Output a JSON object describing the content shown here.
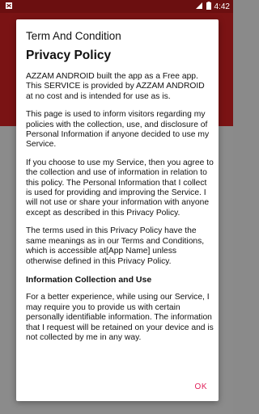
{
  "status_bar": {
    "time": "4:42"
  },
  "dialog": {
    "title": "Term And Condition",
    "heading": "Privacy Policy",
    "paragraphs": [
      "AZZAM ANDROID built the app as a Free app. This SERVICE is provided by AZZAM ANDROID at no cost and is intended for use as is.",
      "This page is used to inform visitors regarding my policies with the collection, use, and disclosure of Personal Information if anyone decided to use my Service.",
      "If you choose to use my Service, then you agree to the collection and use of information in relation to this policy. The Personal Information that I collect is used for providing and improving the Service. I will not use or share your information with anyone except as described in this Privacy Policy.",
      "The terms used in this Privacy Policy have the same meanings as in our Terms and Conditions, which is accessible at[App Name] unless otherwise defined in this Privacy Policy."
    ],
    "section_heading": "Information Collection and Use",
    "section_paragraph": "For a better experience, while using our Service, I may require you to provide us with certain personally identifiable information. The information that I request will be retained on your device and is not collected by me in any way.",
    "ok_label": "OK"
  },
  "colors": {
    "status_bar": "#6b0f10",
    "app_header": "#7a1314",
    "accent": "#e0205a"
  }
}
